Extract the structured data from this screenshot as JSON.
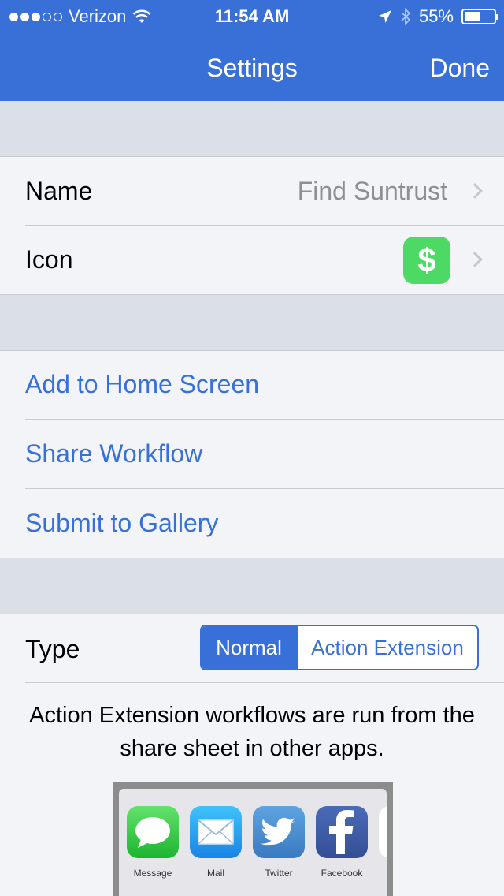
{
  "status_bar": {
    "carrier": "Verizon",
    "time": "11:54 AM",
    "battery": "55%",
    "battery_level": 0.55
  },
  "nav": {
    "title": "Settings",
    "done_label": "Done"
  },
  "settings": {
    "name_label": "Name",
    "name_value": "Find Suntrust",
    "icon_label": "Icon",
    "icon_glyph": "$",
    "icon_color": "#4cd964"
  },
  "actions": {
    "add_home": "Add to Home Screen",
    "share": "Share Workflow",
    "submit": "Submit to Gallery"
  },
  "type": {
    "label": "Type",
    "options": [
      "Normal",
      "Action Extension"
    ],
    "selected": "Normal",
    "description": "Action Extension workflows are run from the share sheet in other apps."
  },
  "share_preview": {
    "apps": [
      {
        "label": "Message",
        "icon": "message-icon"
      },
      {
        "label": "Mail",
        "icon": "mail-icon"
      },
      {
        "label": "Twitter",
        "icon": "twitter-icon"
      },
      {
        "label": "Facebook",
        "icon": "facebook-icon"
      }
    ]
  },
  "colors": {
    "accent": "#3870d8",
    "link": "#3770d6",
    "group_background": "#dbdfe8",
    "cell_background": "#f3f4f8"
  }
}
